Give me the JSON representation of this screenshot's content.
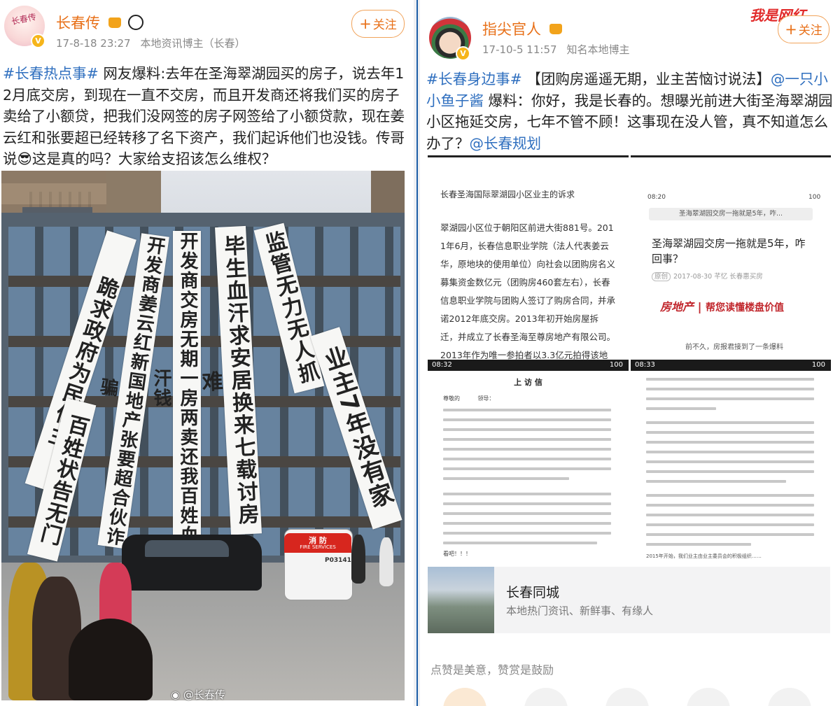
{
  "left_post": {
    "username": "长春传",
    "time": "17-8-18 23:27",
    "source": "本地资讯博主（长春）",
    "follow": "关注",
    "topic": "#长春热点事#",
    "text": " 网友爆料:去年在圣海翠湖园买的房子，说去年12月底交房，到现在一直不交房，而且开发商还将我们买的房子卖给了小额贷，把我们没网签的房子网签给了小额贷款，现在姜云红和张要超已经转移了名下资产，我们起诉他们也没钱。传哥说😎这是真的吗？大家给支招该怎么维权？",
    "avatar_text": "长春传",
    "watermark": "@长春传",
    "banners": [
      "跪求政府为民做主",
      "开发商姜云红新国地产张要超合伙诈骗",
      "开发商交房无期一房两卖还我百姓血汗钱",
      "毕生血汗求安居换来七载讨房难",
      "监管无力无人抓",
      "业主7年没有家"
    ],
    "banner_secondary": "百姓状告无门",
    "fire_truck": "消 防",
    "fire_truck_sub": "FIRE SERVICES",
    "plate": "P03141"
  },
  "right_post": {
    "username": "指尖官人",
    "time": "17-10-5 11:57",
    "source": "知名本地博主",
    "follow": "关注",
    "logo": "我是网红",
    "topic": "#长春身边事#",
    "text_part1": " 【团购房遥遥无期，业主苦恼讨说法】",
    "mention1": "@一只小小鱼子酱",
    "text_part2": " 爆料：你好，我是长春的。想曝光前进大街圣海翠湖园小区拖延交房，七年不管不顾！这事现在没人管，真不知道怎么办了？",
    "mention2": "@长春规划",
    "shot1": {
      "title": "长春圣海国际翠湖园小区业主的诉求",
      "body": "翠湖园小区位于朝阳区前进大街881号。2011年6月，长春信息职业学院（法人代表姜云华，原地块的使用单位）向社会以团购房名义募集资金数亿元（团购房460套左右），长春信息职业学院与团购人签订了购房合同，并承诺2012年底交房。2013年初开始房屋拆迁，并成立了长春圣海至尊房地产有限公司。2013年作为唯一参拍者以3.3亿元拍得该地块。作为朝阳区的重点招商引资"
    },
    "shot2": {
      "status_time": "08:20",
      "battery": "100",
      "url_title": "圣海翠湖园交房一拖就是5年，咋...",
      "title": "圣海翠湖园交房一拖就是5年，咋回事？",
      "tag": "原创",
      "meta": "2017-08-30 芊忆 长春惠买房",
      "brand": "房地产",
      "slogan": "帮您读懂楼盘价值",
      "footer": "前不久，房报君接到了一条爆料"
    },
    "shot3": {
      "status_time": "08:32",
      "battery": "100",
      "title": "上 访 信",
      "greeting": "尊敬的          领导：",
      "ending": "看吧！！！"
    },
    "shot4": {
      "status_time": "08:33",
      "battery": "100",
      "line": "2015年开始，我们业主由业主委员会的积极组织……"
    },
    "card": {
      "title": "长春同城",
      "subtitle": "本地热门资讯、新鲜事、有缘人"
    },
    "reward_text": "点赞是美意，赞赏是鼓励"
  }
}
